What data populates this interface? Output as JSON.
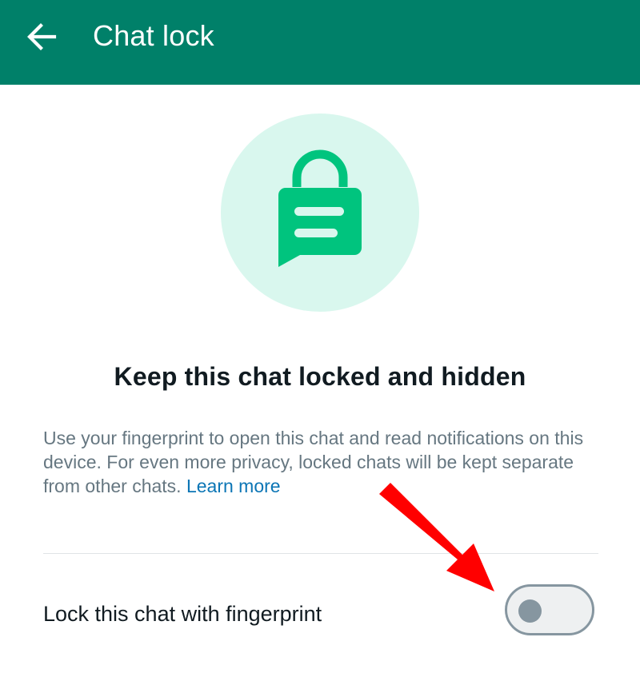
{
  "appbar": {
    "title": "Chat lock",
    "back_icon": "arrow-left-icon",
    "background": "#008069"
  },
  "hero": {
    "icon": "locked-chat-bubble-icon",
    "circle_color": "#d9f7ee",
    "icon_color": "#00c47e"
  },
  "headline": "Keep this chat locked and hidden",
  "description": {
    "text": "Use your fingerprint to open this chat and read notifications on this device. For even more privacy, locked chats will be kept separate from other chats. ",
    "link": "Learn more",
    "link_color": "#0b75b5"
  },
  "setting": {
    "label": "Lock this chat with fingerprint",
    "toggle_on": false
  },
  "annotation": {
    "icon": "red-arrow-icon",
    "color": "#ff0000"
  }
}
